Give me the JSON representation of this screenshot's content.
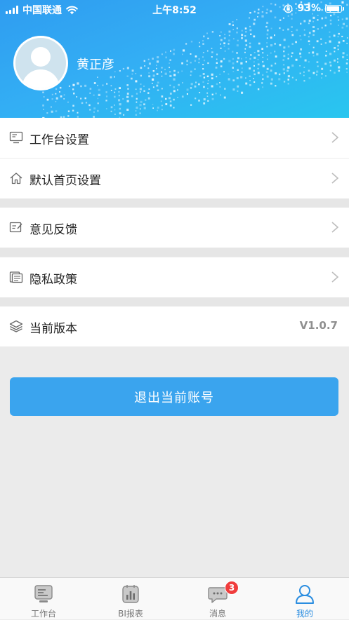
{
  "status_bar": {
    "carrier": "中国联通",
    "time": "上午8:52",
    "battery_text": "93%",
    "battery_level": 0.93
  },
  "profile": {
    "name": "黄正彦"
  },
  "menu": {
    "workbench_settings": "工作台设置",
    "homepage_settings": "默认首页设置",
    "feedback": "意见反馈",
    "privacy_policy": "隐私政策",
    "current_version_label": "当前版本",
    "current_version_value": "V1.0.7"
  },
  "logout_label": "退出当前账号",
  "tabs": [
    {
      "label": "工作台",
      "icon": "workbench-icon"
    },
    {
      "label": "BI报表",
      "icon": "bi-report-icon"
    },
    {
      "label": "消息",
      "icon": "message-icon",
      "badge": "3"
    },
    {
      "label": "我的",
      "icon": "profile-icon",
      "active": true
    }
  ],
  "colors": {
    "accent": "#3aa4ee",
    "header": "#33aef4",
    "badge": "#f03d3d",
    "active_tab": "#2a8de0"
  }
}
